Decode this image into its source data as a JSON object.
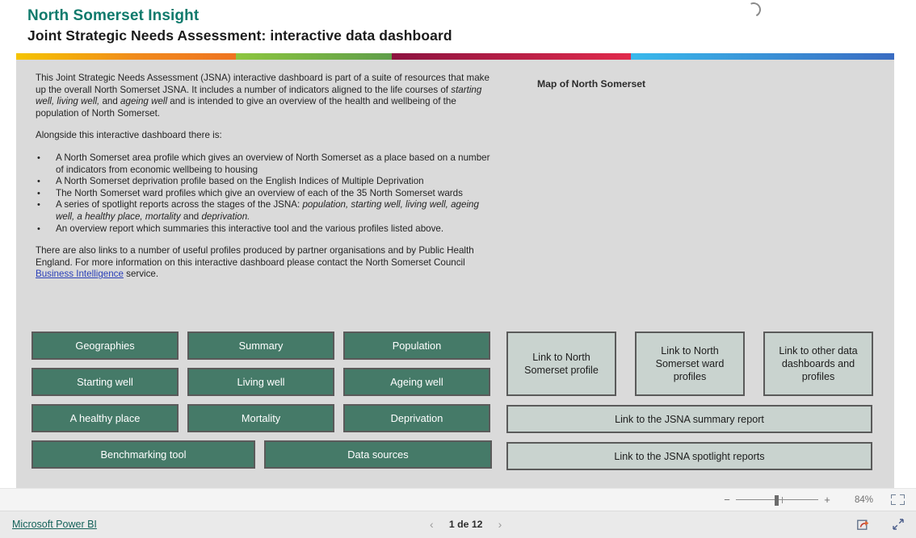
{
  "header": {
    "brand": "North Somerset Insight",
    "title": "Joint Strategic Needs Assessment: interactive data dashboard"
  },
  "ribbon": {
    "colors": [
      "#f5c400",
      "#ef7421",
      "#8dc63f",
      "#5f9e4a",
      "#8c1340",
      "#e12a4c",
      "#39b9ec",
      "#3a6cc2"
    ]
  },
  "intro": {
    "paragraph1": "This Joint Strategic Needs Assessment (JSNA) interactive dashboard is part of a suite of resources that make up the overall North Somerset JSNA. It includes a number of indicators aligned to the life courses of ",
    "paragraph1_italic1": "starting well, living well,",
    "paragraph1_mid": " and ",
    "paragraph1_italic2": "ageing well",
    "paragraph1_end": " and is intended to give an overview of the health and wellbeing of the population of North Somerset.",
    "paragraph2": "Alongside this interactive dashboard there is:",
    "bullets": [
      "A North Somerset area profile which gives an overview of North Somerset as a place based on a number of indicators from economic wellbeing to housing",
      "A North Somerset deprivation profile based on the English Indices of Multiple Deprivation",
      "The North Somerset ward profiles which give an overview of each of the 35 North Somerset wards"
    ],
    "bullet4_lead": "A series of spotlight reports across the stages of the JSNA: ",
    "bullet4_italic1": "population, starting well, living well, ageing well, a healthy place, mortality",
    "bullet4_mid": " and ",
    "bullet4_italic2": "deprivation.",
    "bullet5": "An overview report which summaries this interactive tool and the various profiles listed above.",
    "closing_before_link": "There are also links to a number of useful profiles produced by partner organisations and by Public Health England.  For more information on this interactive dashboard please contact the North Somerset Council ",
    "closing_link": "Business Intelligence",
    "closing_after_link": " service.",
    "bullet_marker": "•"
  },
  "map": {
    "title": "Map of North Somerset"
  },
  "nav_buttons": {
    "rows": [
      [
        "Geographies",
        "Summary",
        "Population"
      ],
      [
        "Starting well",
        "Living well",
        "Ageing well"
      ],
      [
        "A healthy place",
        "Mortality",
        "Deprivation"
      ]
    ],
    "wide_row": [
      "Benchmarking tool",
      "Data sources"
    ],
    "color": "#457a68"
  },
  "link_tiles": {
    "squares": [
      "Link to North Somerset profile",
      "Link to North Somerset ward profiles",
      "Link to other data dashboards and profiles"
    ],
    "bars": [
      "Link to the JSNA summary report",
      "Link to the JSNA spotlight reports"
    ],
    "color": "#c9d3cf"
  },
  "zoom_toolbar": {
    "minus": "−",
    "plus": "+",
    "percent": "84%",
    "fit_icon": "fit-to-page-icon"
  },
  "status_bar": {
    "powerbi_link": "Microsoft Power BI",
    "prev_arrow": "‹",
    "next_arrow": "›",
    "page_label": "1 de 12",
    "share_icon": "share-icon",
    "fullscreen_icon": "fullscreen-icon"
  }
}
